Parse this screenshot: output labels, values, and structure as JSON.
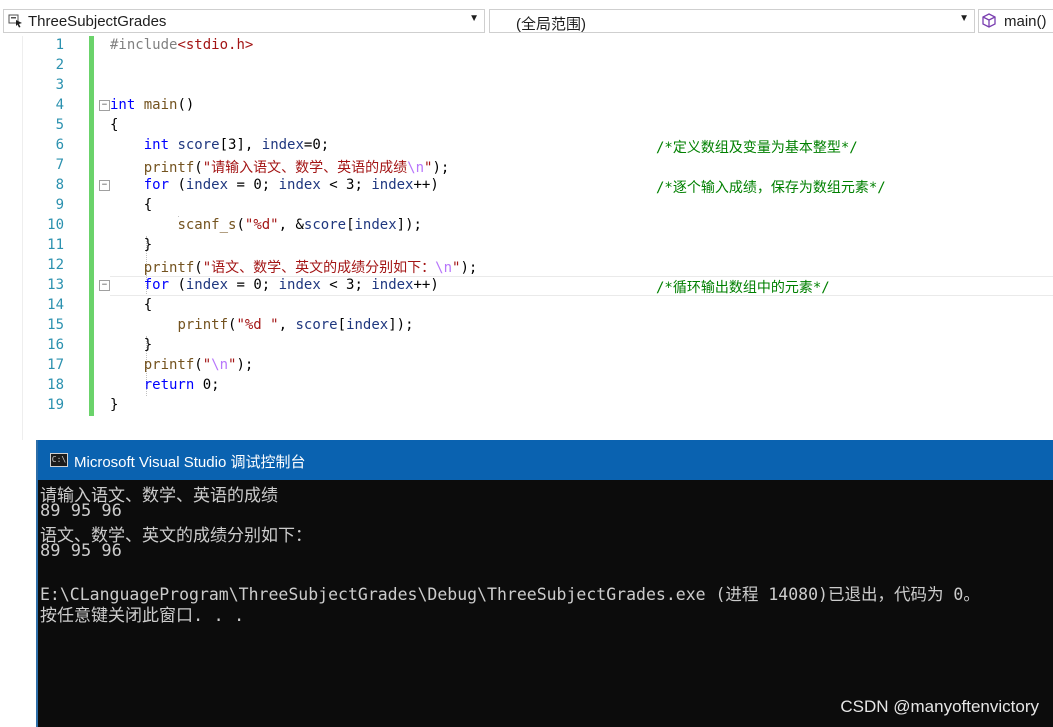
{
  "nav": {
    "project": "ThreeSubjectGrades",
    "scope": "(全局范围)",
    "member": "main()"
  },
  "editor": {
    "lines": [
      {
        "num": "1",
        "text": "#include<stdio.h>"
      },
      {
        "num": "2",
        "text": ""
      },
      {
        "num": "3",
        "text": ""
      },
      {
        "num": "4",
        "text": "int main()"
      },
      {
        "num": "5",
        "text": "{"
      },
      {
        "num": "6",
        "text": "    int score[3], index=0;",
        "comment": "/*定义数组及变量为基本整型*/"
      },
      {
        "num": "7",
        "text": "    printf(\"请输入语文、数学、英语的成绩\\n\");"
      },
      {
        "num": "8",
        "text": "    for (index = 0; index < 3; index++)",
        "comment": "/*逐个输入成绩，保存为数组元素*/"
      },
      {
        "num": "9",
        "text": "    {"
      },
      {
        "num": "10",
        "text": "        scanf_s(\"%d\", &score[index]);"
      },
      {
        "num": "11",
        "text": "    }"
      },
      {
        "num": "12",
        "text": "    printf(\"语文、数学、英文的成绩分别如下：\\n\");"
      },
      {
        "num": "13",
        "text": "    for (index = 0; index < 3; index++)",
        "comment": "/*循环输出数组中的元素*/"
      },
      {
        "num": "14",
        "text": "    {"
      },
      {
        "num": "15",
        "text": "        printf(\"%d \", score[index]);"
      },
      {
        "num": "16",
        "text": "    }"
      },
      {
        "num": "17",
        "text": "    printf(\"\\n\");"
      },
      {
        "num": "18",
        "text": "    return 0;"
      },
      {
        "num": "19",
        "text": "}"
      }
    ]
  },
  "console": {
    "title": "Microsoft Visual Studio 调试控制台",
    "lines": [
      "请输入语文、数学、英语的成绩",
      "89 95 96",
      "语文、数学、英文的成绩分别如下：",
      "89 95 96",
      "",
      "E:\\CLanguageProgram\\ThreeSubjectGrades\\Debug\\ThreeSubjectGrades.exe (进程 14080)已退出，代码为 0。",
      "按任意键关闭此窗口. . ."
    ]
  },
  "watermark": "CSDN @manyoftenvictory"
}
